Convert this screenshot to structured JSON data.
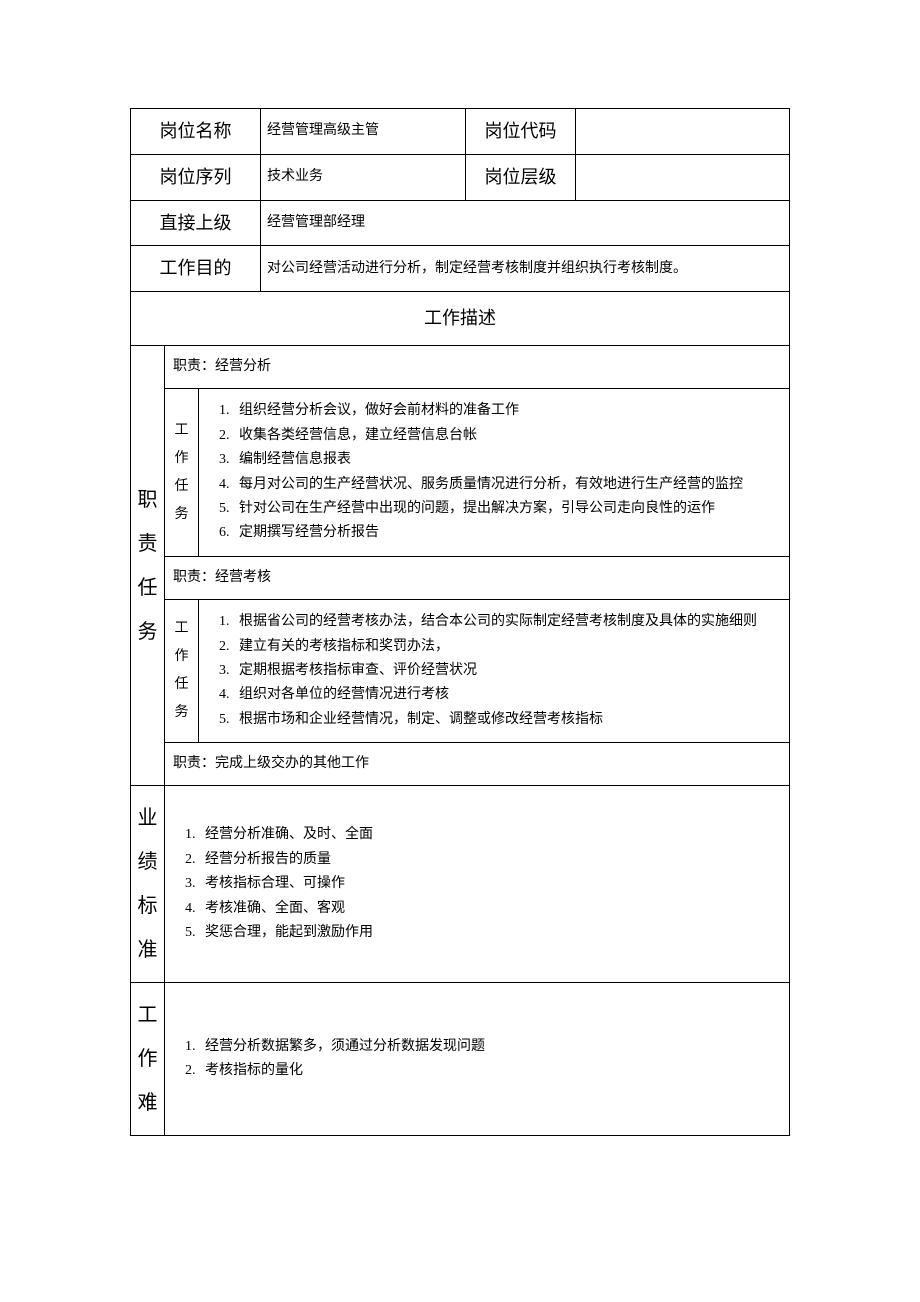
{
  "header": {
    "posNameLabel": "岗位名称",
    "posNameValue": "经营管理高级主管",
    "posCodeLabel": "岗位代码",
    "posCodeValue": "",
    "posSeriesLabel": "岗位序列",
    "posSeriesValue": "技术业务",
    "posLevelLabel": "岗位层级",
    "posLevelValue": "",
    "supervisorLabel": "直接上级",
    "supervisorValue": "经营管理部经理",
    "purposeLabel": "工作目的",
    "purposeValue": "对公司经营活动进行分析，制定经营考核制度并组织执行考核制度。"
  },
  "descTitle": "工作描述",
  "dutiesLabel": "职责任务",
  "taskLabel": "工作任务",
  "duty1": {
    "title": "职责：经营分析",
    "items": [
      "组织经营分析会议，做好会前材料的准备工作",
      "收集各类经营信息，建立经营信息台帐",
      "编制经营信息报表",
      "每月对公司的生产经营状况、服务质量情况进行分析，有效地进行生产经营的监控",
      "针对公司在生产经营中出现的问题，提出解决方案，引导公司走向良性的运作",
      "定期撰写经营分析报告"
    ]
  },
  "duty2": {
    "title": "职责：经营考核",
    "items": [
      "根据省公司的经营考核办法，结合本公司的实际制定经营考核制度及具体的实施细则",
      "建立有关的考核指标和奖罚办法，",
      "定期根据考核指标审查、评价经营状况",
      "组织对各单位的经营情况进行考核",
      "根据市场和企业经营情况，制定、调整或修改经营考核指标"
    ]
  },
  "duty3": {
    "title": "职责：完成上级交办的其他工作"
  },
  "perf": {
    "label": "业绩标准",
    "items": [
      "经营分析准确、及时、全面",
      "经营分析报告的质量",
      "考核指标合理、可操作",
      "考核准确、全面、客观",
      "奖惩合理，能起到激励作用"
    ]
  },
  "diff": {
    "label": "工作难",
    "items": [
      "经营分析数据繁多，须通过分析数据发现问题",
      "考核指标的量化"
    ]
  }
}
